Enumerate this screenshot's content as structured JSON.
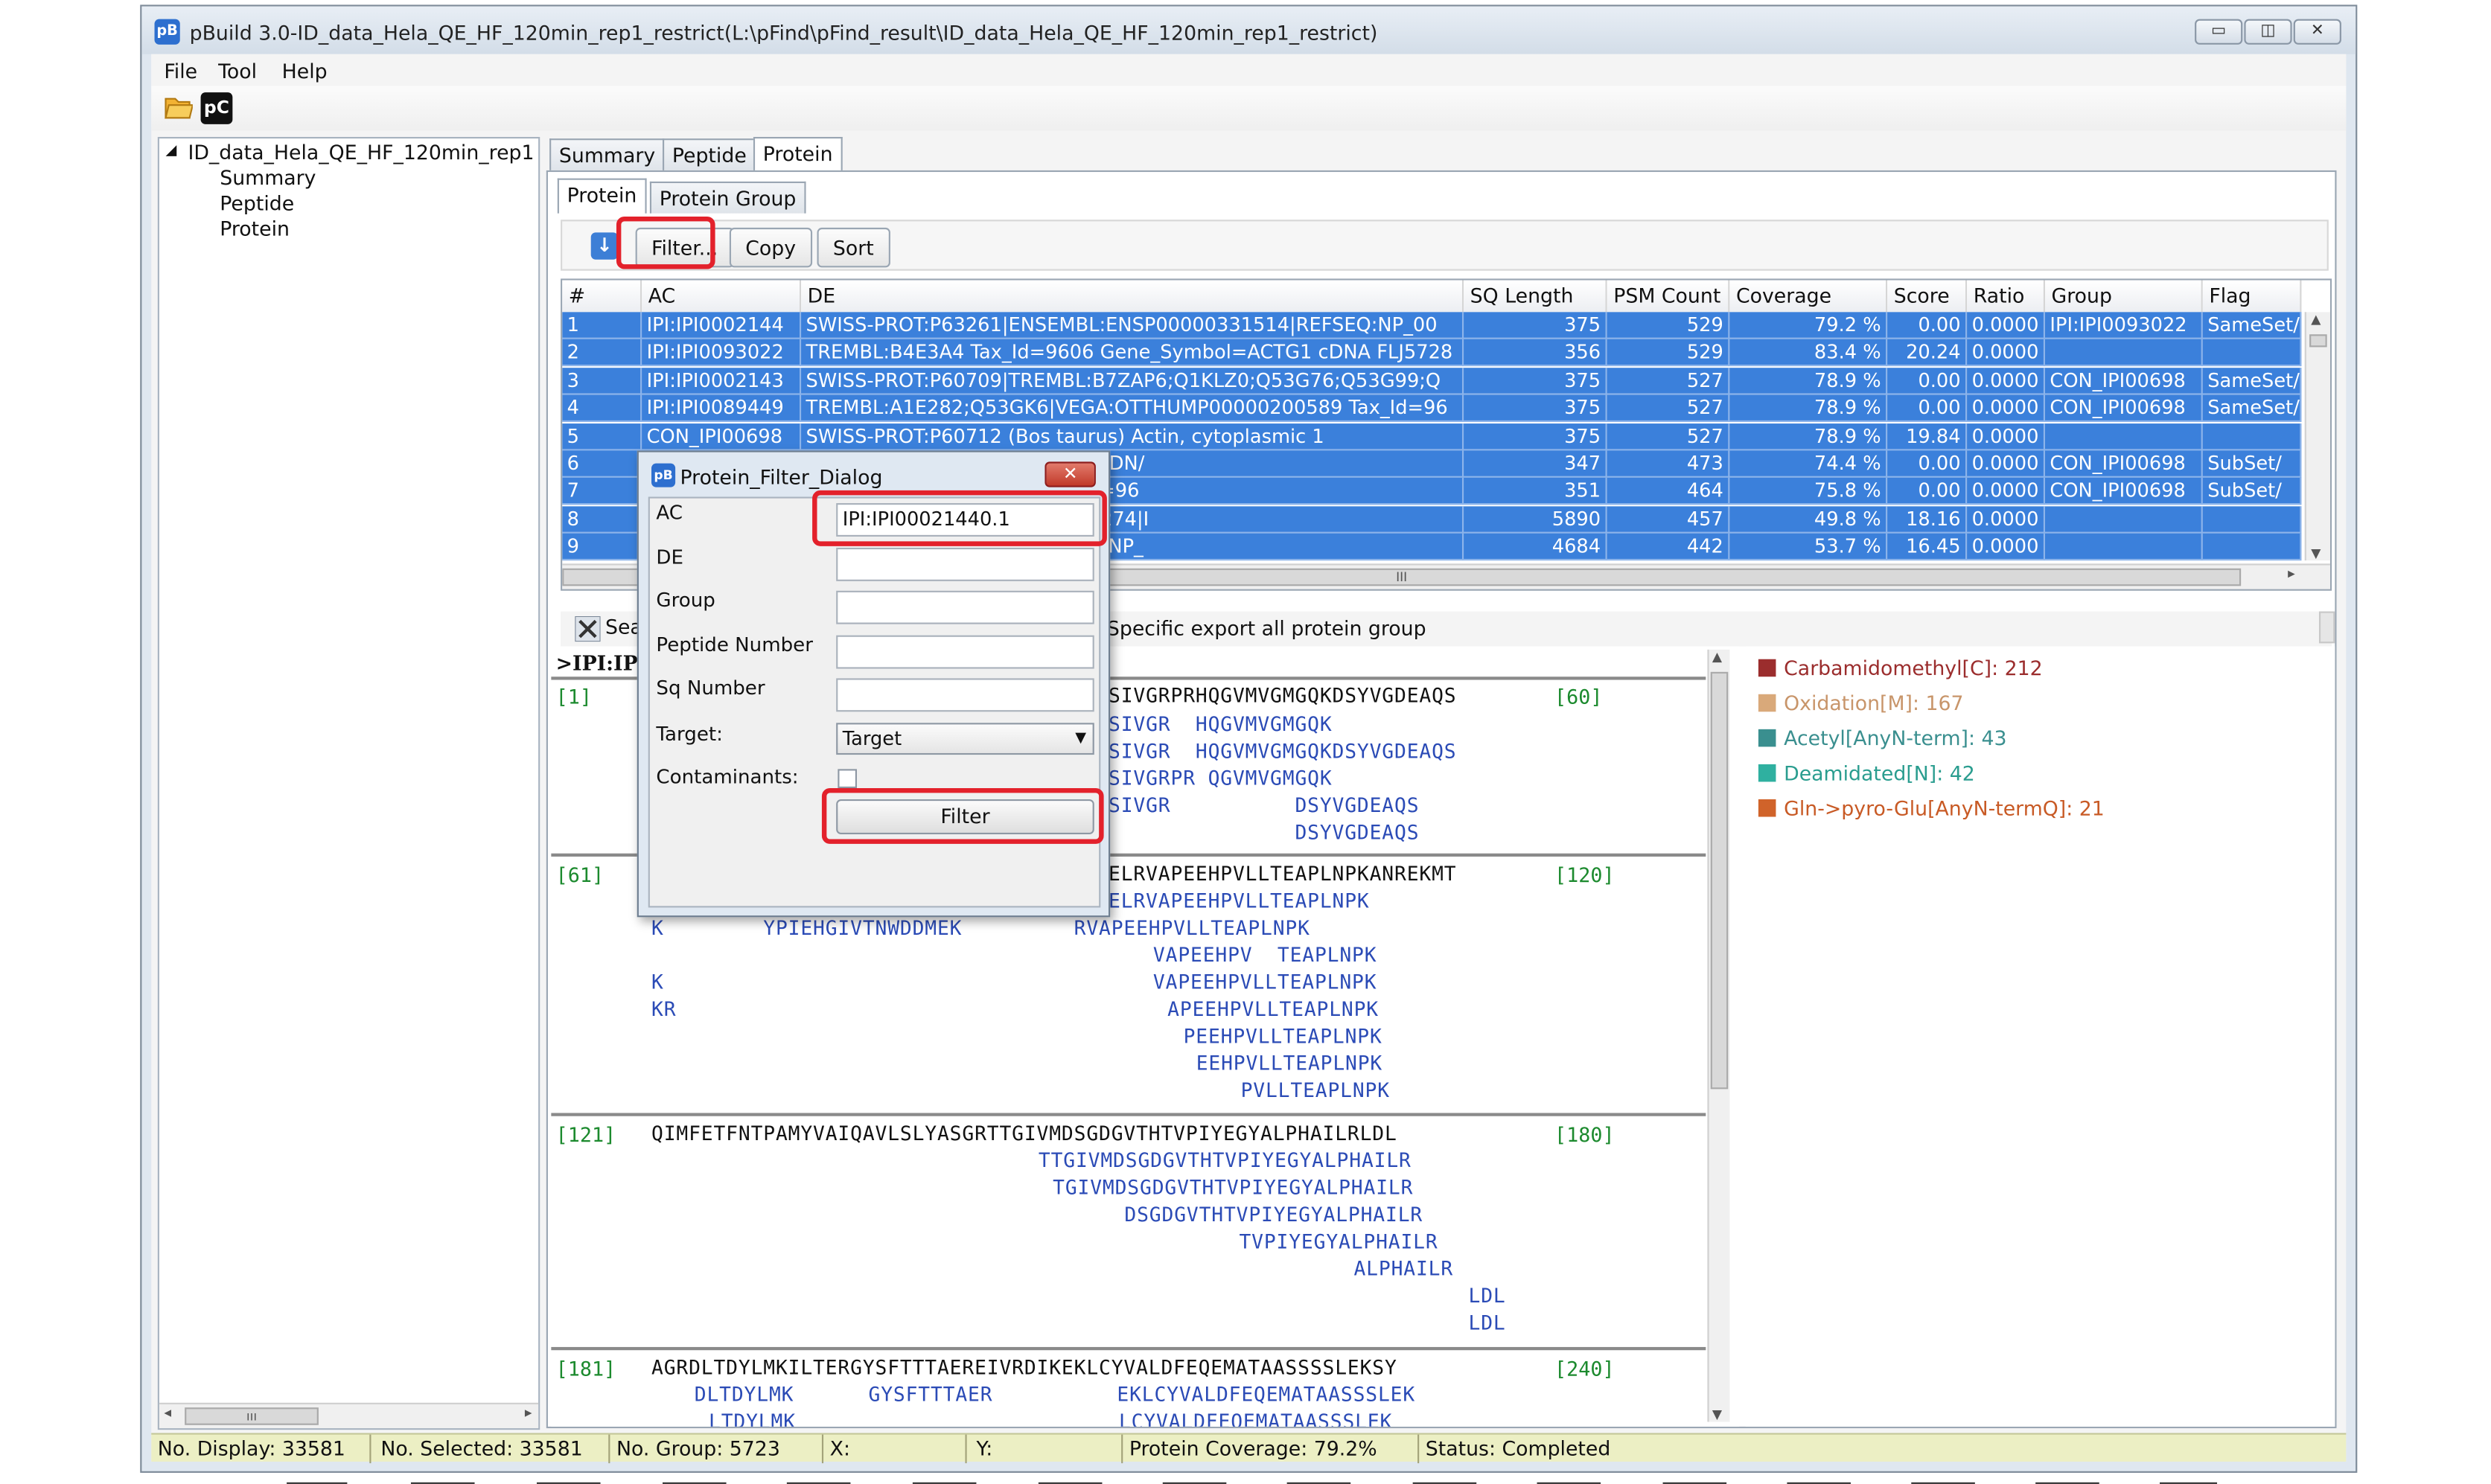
{
  "window": {
    "title": "pBuild 3.0-ID_data_Hela_QE_HF_120min_rep1_restrict(L:\\pFind\\pFind_result\\ID_data_Hela_QE_HF_120min_rep1_restrict)",
    "app_icon": "pB",
    "controls": {
      "minimize": "▭",
      "maximize": "◫",
      "close": "✕"
    }
  },
  "menu": [
    "File",
    "Tool",
    "Help"
  ],
  "toolbar": {
    "open_icon": "folder-open-icon",
    "logo": "pC"
  },
  "tree": {
    "root_arrow": "◢",
    "root": "ID_data_Hela_QE_HF_120min_rep1",
    "children": [
      "Summary",
      "Peptide",
      "Protein"
    ],
    "scroll_thumb": "ııı"
  },
  "main_tabs": [
    "Summary",
    "Peptide",
    "Protein"
  ],
  "sub_tabs": [
    "Protein",
    "Protein Group"
  ],
  "buttons": {
    "download_icon": "↓",
    "filter": "Filter...",
    "copy": "Copy",
    "sort": "Sort"
  },
  "table": {
    "columns": [
      "#",
      "AC",
      "DE",
      "SQ Length",
      "PSM Count",
      "Coverage",
      "Score",
      "Ratio",
      "Group",
      "Flag"
    ],
    "rows": [
      [
        "1",
        "IPI:IPI0002144",
        "SWISS-PROT:P63261|ENSEMBL:ENSP00000331514|REFSEQ:NP_00",
        "375",
        "529",
        "79.2 %",
        "0.00",
        "0.0000",
        "IPI:IPI0093022",
        "SameSet/"
      ],
      [
        "2",
        "IPI:IPI0093022",
        "TREMBL:B4E3A4 Tax_Id=9606 Gene_Symbol=ACTG1 cDNA FLJ5728",
        "356",
        "529",
        "83.4 %",
        "20.24",
        "0.0000",
        "",
        ""
      ],
      [
        "3",
        "IPI:IPI0002143",
        "SWISS-PROT:P60709|TREMBL:B7ZAP6;Q1KLZ0;Q53G76;Q53G99;Q",
        "375",
        "527",
        "78.9 %",
        "0.00",
        "0.0000",
        "CON_IPI00698",
        "SameSet/"
      ],
      [
        "4",
        "IPI:IPI0089449",
        "TREMBL:A1E282;Q53GK6|VEGA:OTTHUMP00000200589 Tax_Id=96",
        "375",
        "527",
        "78.9 %",
        "0.00",
        "0.0000",
        "CON_IPI00698",
        "SameSet/"
      ],
      [
        "5",
        "CON_IPI00698",
        "SWISS-PROT:P60712 (Bos taurus) Actin, cytoplasmic 1",
        "375",
        "527",
        "78.9 %",
        "19.84",
        "0.0000",
        "",
        ""
      ],
      [
        "6",
        "",
        "Id=9606 Gene_Symbol=ACTB cDN/",
        "347",
        "473",
        "74.4 %",
        "0.00",
        "0.0000",
        "CON_IPI00698",
        "SubSet/"
      ],
      [
        "7",
        "",
        "OTTHUMP00000200588 Tax_Id=96",
        "351",
        "464",
        "75.8 %",
        "0.00",
        "0.0000",
        "CON_IPI00698",
        "SubSet/"
      ],
      [
        "8",
        "",
        "34DTV0;Q13727;Q6ZQN2;Q8N274|I",
        "5890",
        "457",
        "49.8 %",
        "18.16",
        "0.0000",
        "",
        ""
      ],
      [
        "9",
        "",
        "BL:ENSP00000323856|REFSEQ:NP_",
        "4684",
        "442",
        "53.7 %",
        "16.45",
        "0.0000",
        "",
        ""
      ]
    ],
    "scroll_thumb": "III"
  },
  "seq_toolbar": {
    "tool_icon": "tools-icon",
    "search_partial": "Sea",
    "specific_text": "Specific export all protein group"
  },
  "protein_header": ">IPI:IPI",
  "coverage": {
    "blocks": [
      {
        "start": "[1]",
        "end": "[60]",
        "main": "SIVGRPRHQGVMVGMGQKDSYVGDEAQS",
        "peptides": [
          "SIVGR  HQGVMVGMGQK",
          "SIVGR  HQGVMVGMGQKDSYVGDEAQS",
          "SIVGRPR QGVMVGMGQK",
          "SIVGR          DSYVGDEAQS",
          "               DSYVGDEAQS"
        ]
      },
      {
        "start": "[61]",
        "end": "[120]",
        "main": "ELRVAPEEHPVLLTEAPLNPKANREKMT",
        "peptides": [
          "ELRVAPEEHPVLLTEAPLNPK",
          "K        YPIEHGIVTNWDDMEK         RVAPEEHPVLLTEAPLNPK",
          "VAPEEHPV  TEAPLNPK",
          "K",
          "VAPEEHPVLLTEAPLNPK",
          "KR",
          "APEEHPVLLTEAPLNPK",
          "PEEHPVLLTEAPLNPK",
          "EEHPVLLTEAPLNPK",
          "PVLLTEAPLNPK"
        ]
      },
      {
        "start": "[121]",
        "end": "[180]",
        "main": "QIMFETFNTPAMYVAIQAVLSLYASGRTTGIVMDSGDGVTHTVPIYEGYALPHAILRLDL",
        "peptides": [
          "TTGIVMDSGDGVTHTVPIYEGYALPHAILR",
          "TGIVMDSGDGVTHTVPIYEGYALPHAILR",
          "DSGDGVTHTVPIYEGYALPHAILR",
          "TVPIYEGYALPHAILR",
          "ALPHAILR",
          "LDL",
          "LDL"
        ]
      },
      {
        "start": "[181]",
        "end": "[240]",
        "main": "AGRDLTDYLMKILTERGYSFTTTAEREIVRDIKEKLCYVALDFEQEMATAASSSSLEKSY",
        "peptides": [
          "DLTDYLMK      GYSFTTTAER          EKLCYVALDFEQEMATAASSSLEK",
          "LTDYLMK                          LCYVALDFEQEMATAASSSLEK"
        ]
      }
    ]
  },
  "modifications": [
    {
      "label": "Carbamidomethyl[C]: 212",
      "color": "#9b2d2d",
      "text_color": "#9b2d2d"
    },
    {
      "label": "Oxidation[M]: 167",
      "color": "#d9a97a",
      "text_color": "#c8956a"
    },
    {
      "label": "Acetyl[AnyN-term]: 43",
      "color": "#3a8f8f",
      "text_color": "#3a8f8f"
    },
    {
      "label": "Deamidated[N]: 42",
      "color": "#2fb0a0",
      "text_color": "#2a9d8f"
    },
    {
      "label": "Gln->pyro-Glu[AnyN-termQ]: 21",
      "color": "#d0632a",
      "text_color": "#c85a25"
    }
  ],
  "status": {
    "display": "No. Display: 33581",
    "selected": "No. Selected: 33581",
    "group": "No. Group: 5723",
    "x": "X:",
    "y": "Y:",
    "coverage": "Protein Coverage: 79.2%",
    "status": "Status:  Completed"
  },
  "filter_dialog": {
    "title": "Protein_Filter_Dialog",
    "close": "✕",
    "labels": {
      "ac": "AC",
      "de": "DE",
      "group": "Group",
      "peptide_number": "Peptide Number",
      "sq_number": "Sq Number",
      "target": "Target:",
      "contaminants": "Contaminants:"
    },
    "ac_value": "IPI:IPI00021440.1",
    "target_value": "Target",
    "filter_button": "Filter",
    "contaminants_checked": false
  },
  "colors": {
    "selection": "#3b80db",
    "highlight": "#e3212b",
    "status_bar": "#ecefc4",
    "peptide": "#2b4bb6",
    "position": "#1c8a2e"
  }
}
